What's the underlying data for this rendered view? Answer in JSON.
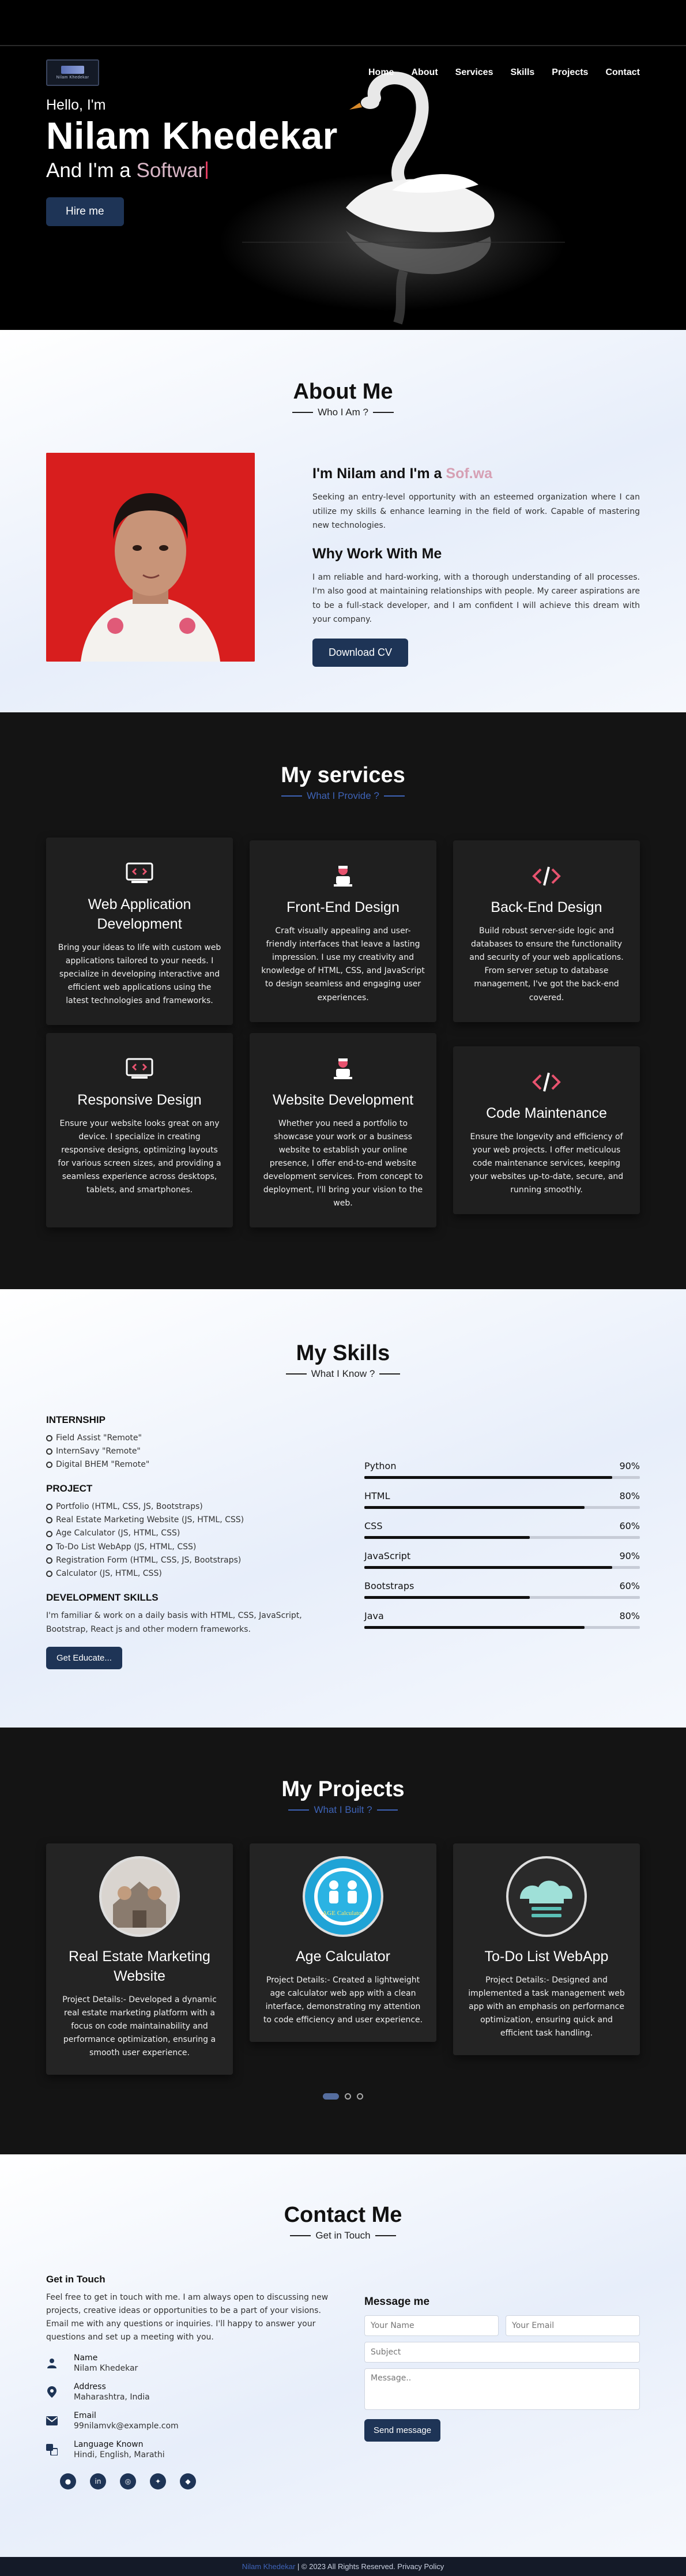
{
  "nav": {
    "items": [
      "Home",
      "About",
      "Services",
      "Skills",
      "Projects",
      "Contact"
    ]
  },
  "hero": {
    "hello": "Hello, I'm",
    "name": "Nilam Khedekar",
    "role_prefix": "And I'm a",
    "role_typed": "Softwar",
    "hire_label": "Hire me"
  },
  "about": {
    "title": "About Me",
    "subtitle": "Who I Am ?",
    "heading_prefix": "I'm Nilam and I'm a",
    "heading_typed": "Sof.wa",
    "intro": "Seeking an entry-level opportunity with an esteemed organization where I can utilize my skills & enhance learning in the field of work. Capable of mastering new technologies.",
    "why_title": "Why Work With Me",
    "why_text": "I am reliable and hard-working, with a thorough understanding of all processes. I'm also good at maintaining relationships with people. My career aspirations are to be a full-stack developer, and I am confident I will achieve this dream with your company.",
    "cv_label": "Download CV"
  },
  "services": {
    "title": "My services",
    "subtitle": "What I Provide ?",
    "cards": [
      {
        "icon": "code-window-icon",
        "title": "Web Application Development",
        "text": "Bring your ideas to life with custom web applications tailored to your needs. I specialize in developing interactive and efficient web applications using the latest technologies and frameworks."
      },
      {
        "icon": "developer-icon",
        "title": "Front-End Design",
        "text": "Craft visually appealing and user-friendly interfaces that leave a lasting impression. I use my creativity and knowledge of HTML, CSS, and JavaScript to design seamless and engaging user experiences."
      },
      {
        "icon": "code-tag-icon",
        "title": "Back-End Design",
        "text": "Build robust server-side logic and databases to ensure the functionality and security of your web applications. From server setup to database management, I've got the back-end covered."
      },
      {
        "icon": "code-window-icon",
        "title": "Responsive Design",
        "text": "Ensure your website looks great on any device. I specialize in creating responsive designs, optimizing layouts for various screen sizes, and providing a seamless experience across desktops, tablets, and smartphones."
      },
      {
        "icon": "developer-icon",
        "title": "Website Development",
        "text": "Whether you need a portfolio to showcase your work or a business website to establish your online presence, I offer end-to-end website development services. From concept to deployment, I'll bring your vision to the web."
      },
      {
        "icon": "code-tag-icon",
        "title": "Code Maintenance",
        "text": "Ensure the longevity and efficiency of your web projects. I offer meticulous code maintenance services, keeping your websites up-to-date, secure, and running smoothly."
      }
    ]
  },
  "skills": {
    "title": "My Skills",
    "subtitle": "What I Know ?",
    "internship_title": "INTERNSHIP",
    "internships": [
      "Field Assist \"Remote\"",
      "InternSavy \"Remote\"",
      "Digital BHEM \"Remote\""
    ],
    "project_title": "PROJECT",
    "projects": [
      "Portfolio (HTML, CSS, JS, Bootstraps)",
      "Real Estate Marketing Website (JS, HTML, CSS)",
      "Age Calculator (JS, HTML, CSS)",
      "To-Do List WebApp (JS, HTML, CSS)",
      "Registration Form (HTML, CSS, JS, Bootstraps)",
      "Calculator (JS, HTML, CSS)"
    ],
    "dev_title": "DEVELOPMENT SKILLS",
    "dev_text": "I'm familiar & work on a daily basis with HTML, CSS, JavaScript, Bootstrap, React js and other modern frameworks.",
    "btn_label": "Get Educate...",
    "bars": [
      {
        "name": "Python",
        "pct": 90,
        "label": "90%"
      },
      {
        "name": "HTML",
        "pct": 80,
        "label": "80%"
      },
      {
        "name": "CSS",
        "pct": 60,
        "label": "60%"
      },
      {
        "name": "JavaScript",
        "pct": 90,
        "label": "90%"
      },
      {
        "name": "Bootstraps",
        "pct": 60,
        "label": "60%"
      },
      {
        "name": "Java",
        "pct": 80,
        "label": "80%"
      }
    ]
  },
  "projects": {
    "title": "My Projects",
    "subtitle": "What I Built ?",
    "cards": [
      {
        "title": "Real Estate Marketing Website",
        "text": "Project Details:- Developed a dynamic real estate marketing platform with a focus on code maintainability and performance optimization, ensuring a smooth user experience."
      },
      {
        "title": "Age Calculator",
        "text": "Project Details:- Created a lightweight age calculator web app with a clean interface, demonstrating my attention to code efficiency and user experience."
      },
      {
        "title": "To-Do List WebApp",
        "text": "Project Details:- Designed and implemented a task management web app with an emphasis on performance optimization, ensuring quick and efficient task handling."
      }
    ],
    "age_logo_text": "AGE Calculator"
  },
  "contact": {
    "title": "Contact Me",
    "subtitle": "Get in Touch",
    "left_title": "Get in Touch",
    "left_text": "Feel free to get in touch with me. I am always open to discussing new projects, creative ideas or opportunities to be a part of your visions. Email me with any questions or inquiries. I'll happy to answer your questions and set up a meeting with you.",
    "info": [
      {
        "icon": "user-icon",
        "key": "Name",
        "value": "Nilam Khedekar"
      },
      {
        "icon": "location-icon",
        "key": "Address",
        "value": "Maharashtra, India"
      },
      {
        "icon": "envelope-icon",
        "key": "Email",
        "value": "99nilamvk@example.com"
      },
      {
        "icon": "language-icon",
        "key": "Language Known",
        "value": "Hindi, English, Marathi"
      }
    ],
    "socials": [
      "github-icon",
      "linkedin-icon",
      "instagram-icon",
      "twitter-icon",
      "codepen-icon"
    ],
    "form_title": "Message me",
    "ph_name": "Your Name",
    "ph_email": "Your Email",
    "ph_subject": "Subject",
    "ph_message": "Message..",
    "send_label": "Send message"
  },
  "footer": {
    "brand": "Nilam Khedekar",
    "text": "| © 2023 All Rights Reserved. Privacy Policy"
  },
  "colors": {
    "accent": "#3e63b7",
    "button": "#1e3456",
    "dark_bg": "#141414",
    "card_bg": "#1f1f1f"
  }
}
